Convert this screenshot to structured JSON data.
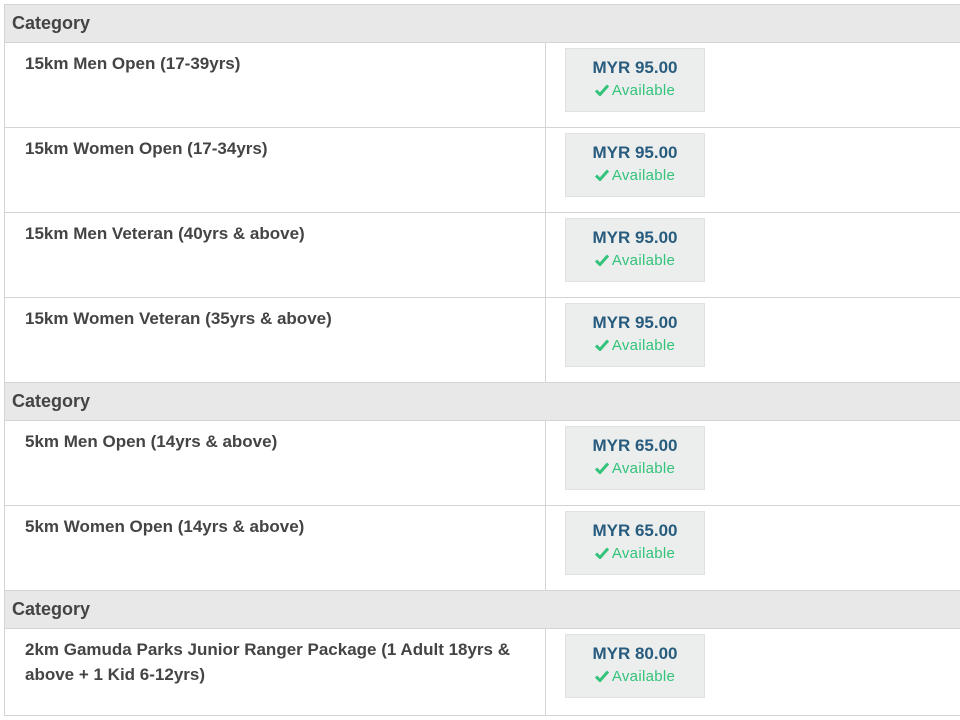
{
  "groups": [
    {
      "header": "Category",
      "rows": [
        {
          "name": "15km Men Open (17-39yrs)",
          "price": "MYR 95.00",
          "status": "Available"
        },
        {
          "name": "15km Women Open (17-34yrs)",
          "price": "MYR 95.00",
          "status": "Available"
        },
        {
          "name": "15km Men Veteran (40yrs & above)",
          "price": "MYR 95.00",
          "status": "Available"
        },
        {
          "name": "15km Women Veteran (35yrs & above)",
          "price": "MYR 95.00",
          "status": "Available"
        }
      ]
    },
    {
      "header": "Category",
      "rows": [
        {
          "name": "5km Men Open (14yrs & above)",
          "price": "MYR 65.00",
          "status": "Available"
        },
        {
          "name": "5km Women Open (14yrs & above)",
          "price": "MYR 65.00",
          "status": "Available"
        }
      ]
    },
    {
      "header": "Category",
      "rows": [
        {
          "name": "2km Gamuda Parks Junior Ranger Package (1 Adult 18yrs & above + 1 Kid 6-12yrs)",
          "price": "MYR 80.00",
          "status": "Available"
        }
      ]
    }
  ],
  "colors": {
    "price": "#285c7e",
    "available": "#33c37a",
    "header_bg": "#e8e8e8"
  },
  "icons": {
    "status": "check-icon"
  }
}
